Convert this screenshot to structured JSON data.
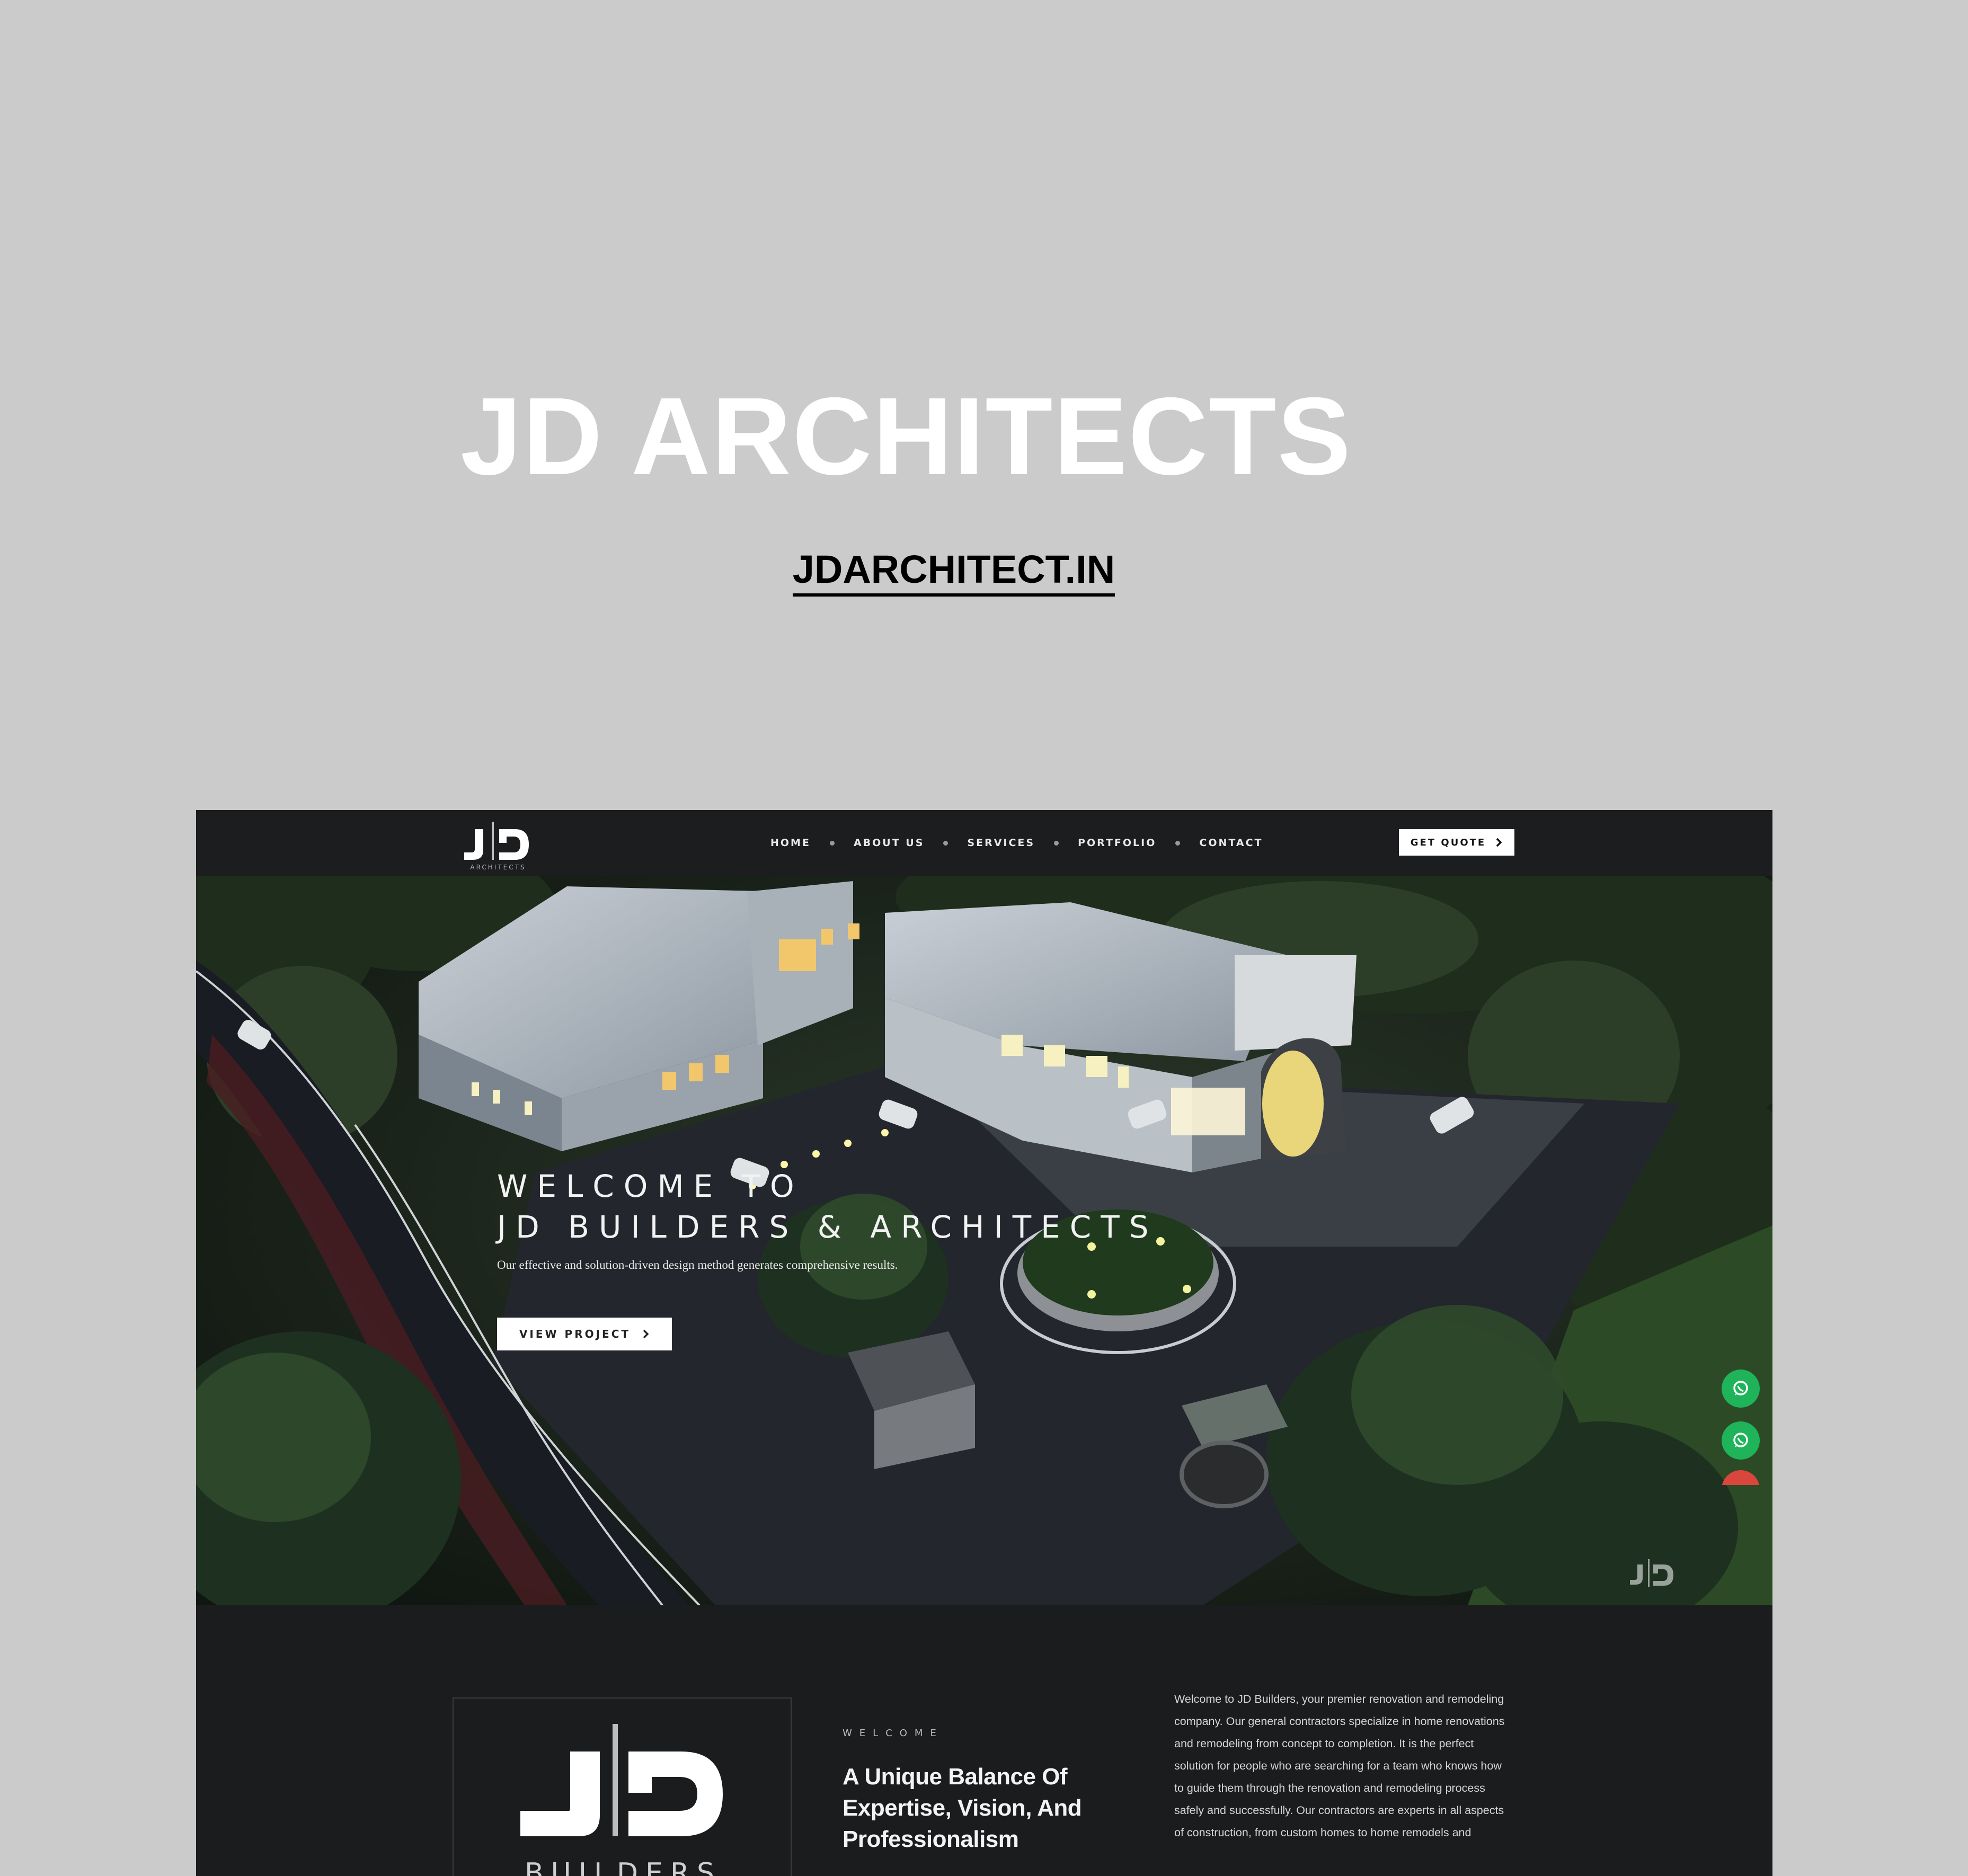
{
  "page": {
    "title": "JD ARCHITECTS",
    "link": "JDARCHITECT.IN"
  },
  "site": {
    "logo_sub": "ARCHITECTS",
    "nav": {
      "items": [
        "HOME",
        "ABOUT US",
        "SERVICES",
        "PORTFOLIO",
        "CONTACT"
      ],
      "quote_button": "GET QUOTE"
    },
    "hero": {
      "line1": "WELCOME TO",
      "line2": "JD BUILDERS & ARCHITECTS",
      "subtitle": "Our effective and solution-driven design method generates comprehensive results.",
      "button": "VIEW PROJECT",
      "watermark": "JD ARCHITECTS"
    },
    "side_icons": [
      "whatsapp-icon",
      "whatsapp-icon"
    ],
    "about": {
      "logo_word": "BUILDERS",
      "label": "WELCOME",
      "heading": "A Unique Balance Of Expertise, Vision, And Professionalism",
      "body": "Welcome to JD Builders, your premier renovation and remodeling company. Our general contractors specialize in home renovations and remodeling from concept to completion. It is the perfect solution for people who are searching for a team who knows how to guide them through the renovation and remodeling process safely and successfully. Our contractors are experts in all aspects of construction, from custom homes to home remodels and"
    },
    "colors": {
      "page_bg": "#cbcbcb",
      "site_bg": "#1b1c1e",
      "whatsapp": "#1fb35a",
      "accent_red": "#d8463c"
    }
  }
}
